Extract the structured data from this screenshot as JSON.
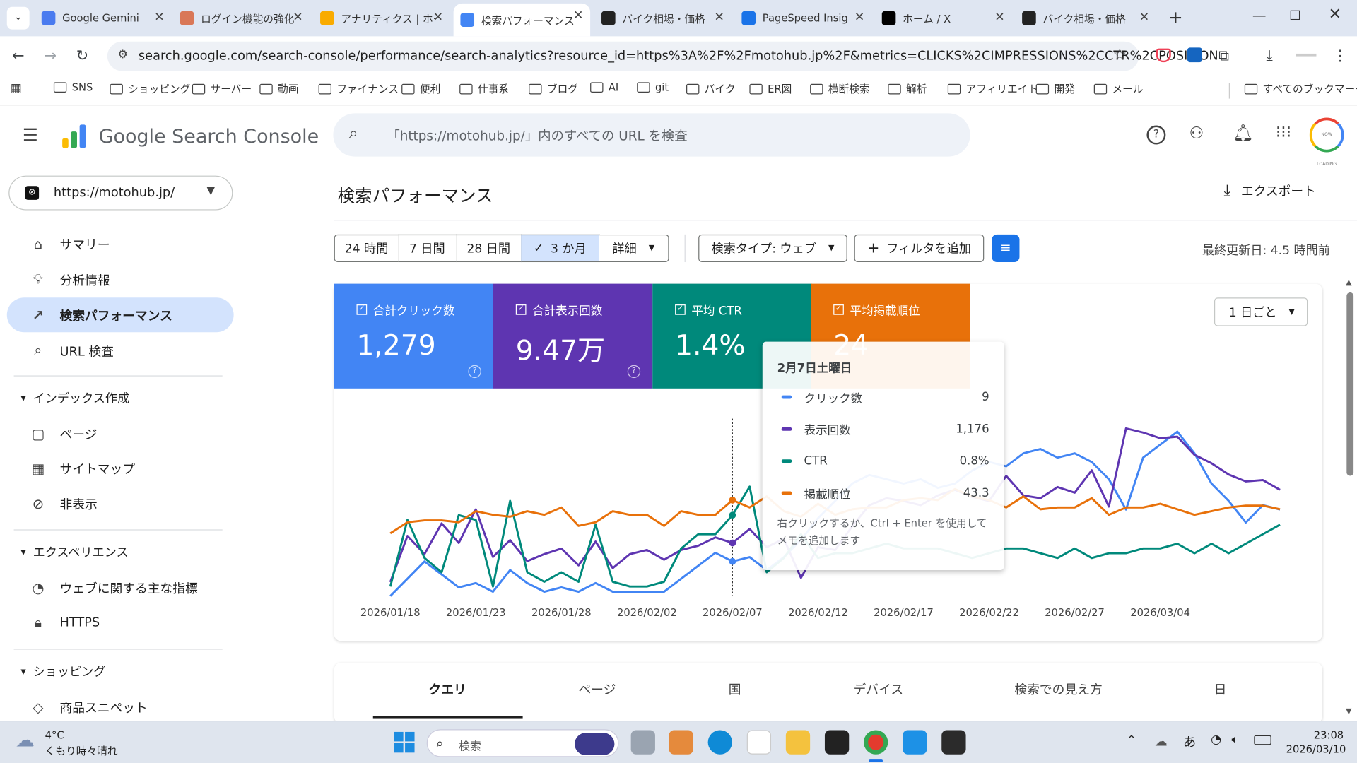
{
  "browser": {
    "tabs": [
      {
        "label": "Google Gemini",
        "icon": "gemini-icon",
        "color": "#4a7bef"
      },
      {
        "label": "ログイン機能の強化",
        "icon": "claude-icon",
        "color": "#d97757"
      },
      {
        "label": "アナリティクス | ホー",
        "icon": "analytics-icon",
        "color": "#f9ab00"
      },
      {
        "label": "検索パフォーマンス",
        "icon": "search-console-icon",
        "color": "#4285f4"
      },
      {
        "label": "バイク相場・価格",
        "icon": "motohub-icon",
        "color": "#222222"
      },
      {
        "label": "PageSpeed Insig",
        "icon": "pagespeed-icon",
        "color": "#1a73e8"
      },
      {
        "label": "ホーム / X",
        "icon": "x-icon",
        "color": "#000000"
      },
      {
        "label": "バイク相場・価格",
        "icon": "motohub-icon",
        "color": "#222222"
      }
    ],
    "url": "search.google.com/search-console/performance/search-analytics?resource_id=https%3A%2F%2Fmotohub.jp%2F&metrics=CLICKS%2CIMPRESSIONS%2CCTR%2CPOSITION",
    "bookmarks": [
      "SNS",
      "ショッピング",
      "サーバー",
      "動画",
      "ファイナンス",
      "便利",
      "仕事系",
      "ブログ",
      "AI",
      "git",
      "バイク",
      "ER図",
      "横断検索",
      "解析",
      "アフィリエイト",
      "開発",
      "メール"
    ],
    "all_bookmarks": "すべてのブックマーク",
    "profile_text": "NOW LOADING"
  },
  "gsc": {
    "logo_text": "Google Search Console",
    "search_placeholder": "「https://motohub.jp/」内のすべての URL を検査",
    "property": "https://motohub.jp/",
    "nav": [
      {
        "label": "サマリー",
        "icon": "home-icon"
      },
      {
        "label": "分析情報",
        "icon": "lightbulb-icon"
      },
      {
        "label": "検索パフォーマンス",
        "icon": "trending-up-icon"
      },
      {
        "label": "URL 検査",
        "icon": "search-icon"
      }
    ],
    "sections": [
      {
        "title": "インデックス作成",
        "items": [
          "ページ",
          "サイトマップ",
          "非表示"
        ]
      },
      {
        "title": "エクスペリエンス",
        "items": [
          "ウェブに関する主な指標",
          "HTTPS"
        ]
      },
      {
        "title": "ショッピング",
        "items": [
          "商品スニペット"
        ]
      }
    ],
    "page_title": "検索パフォーマンス",
    "export_label": "エクスポート",
    "range_pills": [
      "24 時間",
      "7 日間",
      "28 日間",
      "3 か月",
      "詳細"
    ],
    "search_type": "検索タイプ: ウェブ",
    "add_filter": "フィルタを追加",
    "last_updated": "最終更新日: 4.5 時間前",
    "granularity": "1 日ごと",
    "metrics": [
      {
        "label": "合計クリック数",
        "value": "1,279",
        "color": "#4285f4"
      },
      {
        "label": "合計表示回数",
        "value": "9.47万",
        "color": "#5e35b1"
      },
      {
        "label": "平均 CTR",
        "value": "1.4%",
        "color": "#00897b"
      },
      {
        "label": "平均掲載順位",
        "value": "24",
        "color": "#e8710a"
      }
    ],
    "tooltip": {
      "date": "2月7日土曜日",
      "rows": [
        {
          "label": "クリック数",
          "value": "9",
          "color": "#4285f4"
        },
        {
          "label": "表示回数",
          "value": "1,176",
          "color": "#5e35b1"
        },
        {
          "label": "CTR",
          "value": "0.8%",
          "color": "#00897b"
        },
        {
          "label": "掲載順位",
          "value": "43.3",
          "color": "#e8710a"
        }
      ],
      "hint": "右クリックするか、Ctrl + Enter を使用してメモを追加します"
    },
    "bottom_tabs": [
      "クエリ",
      "ページ",
      "国",
      "デバイス",
      "検索での見え方",
      "日"
    ]
  },
  "chart_data": {
    "type": "line",
    "x_ticks": [
      "2026/01/18",
      "2026/01/23",
      "2026/01/28",
      "2026/02/02",
      "2026/02/07",
      "2026/02/12",
      "2026/02/17",
      "2026/02/22",
      "2026/02/27",
      "2026/03/04"
    ],
    "x_start": "2026/01/18",
    "x_end": "2026/03/09",
    "y_axis_labels": "hidden",
    "series": [
      {
        "name": "クリック数",
        "color": "#4285f4",
        "values": [
          0,
          4,
          8,
          5,
          2,
          3,
          1,
          6,
          3,
          1,
          2,
          1,
          3,
          1,
          1,
          1,
          1,
          4,
          7,
          10,
          8,
          9,
          6,
          9,
          13,
          18,
          22,
          26,
          28,
          27,
          26,
          27,
          25,
          26,
          29,
          31,
          30,
          33,
          34,
          32,
          33,
          31,
          27,
          20,
          32,
          35,
          38,
          33,
          26,
          22,
          17,
          21,
          20
        ]
      },
      {
        "name": "表示回数",
        "color": "#5e35b1",
        "values": [
          100,
          430,
          300,
          520,
          380,
          620,
          280,
          400,
          250,
          300,
          340,
          220,
          390,
          200,
          300,
          330,
          260,
          330,
          360,
          420,
          380,
          480,
          350,
          410,
          130,
          350,
          330,
          500,
          650,
          700,
          680,
          650,
          720,
          760,
          710,
          680,
          860,
          720,
          700,
          780,
          740,
          900,
          640,
          1200,
          1170,
          1130,
          1140,
          1010,
          950,
          870,
          820,
          830,
          760
        ]
      },
      {
        "name": "CTR",
        "color": "#00897b",
        "values": [
          0.2,
          1.6,
          0.8,
          0.5,
          1.7,
          1.6,
          0.2,
          2.0,
          0.5,
          0.3,
          0.5,
          0.3,
          1.5,
          0.3,
          0.2,
          0.2,
          0.3,
          1.0,
          1.3,
          1.3,
          1.7,
          2.3,
          0.5,
          0.8,
          1.3,
          0.8,
          0.9,
          0.9,
          1.0,
          1.1,
          1.0,
          1.0,
          1.0,
          0.9,
          0.8,
          0.9,
          1.0,
          1.0,
          0.9,
          0.8,
          1.0,
          0.8,
          0.9,
          0.9,
          1.0,
          1.0,
          1.1,
          0.9,
          1.1,
          0.9,
          1.1,
          1.3,
          1.5
        ]
      },
      {
        "name": "掲載順位",
        "color": "#e8710a",
        "values": [
          34,
          40,
          41,
          41,
          40,
          46,
          44,
          43,
          46,
          44,
          48,
          38,
          40,
          46,
          44,
          44,
          38,
          46,
          44,
          44,
          52,
          48,
          54,
          46,
          43,
          50,
          44,
          47,
          48,
          48,
          52,
          53,
          52,
          58,
          54,
          52,
          48,
          54,
          47,
          48,
          48,
          53,
          44,
          48,
          48,
          50,
          47,
          44,
          46,
          48,
          49,
          49,
          47
        ]
      }
    ]
  },
  "taskbar": {
    "weather_temp": "4°C",
    "weather_desc": "くもり時々晴れ",
    "search_label": "検索",
    "time": "23:08",
    "date": "2026/03/10",
    "ime": "あ"
  }
}
